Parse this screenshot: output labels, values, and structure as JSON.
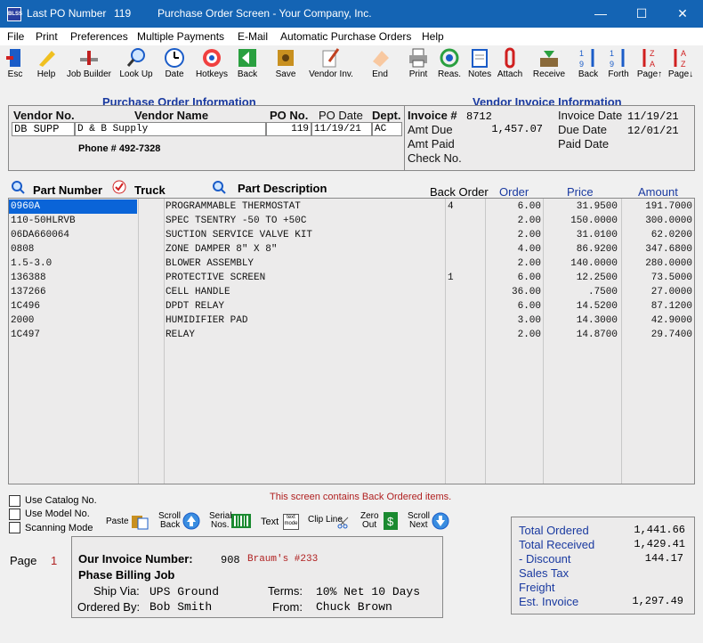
{
  "title_bar": {
    "app_icon": "BLSS",
    "last_po_label": "Last PO Number",
    "last_po_value": "119",
    "window_title": "Purchase Order Screen - Your Company, Inc.",
    "minimize": "—",
    "maximize": "☐",
    "close": "✕"
  },
  "menu": [
    "File",
    "Print",
    "Preferences",
    "Multiple Payments",
    "E-Mail",
    "Automatic Purchase Orders",
    "Help"
  ],
  "toolbar": [
    "Esc",
    "Help",
    "Job Builder",
    "Look Up",
    "Date",
    "Hotkeys",
    "Back",
    "Save",
    "Vendor Inv.",
    "End",
    "Print",
    "Reas.",
    "Notes",
    "Attach",
    "Receive",
    "Back",
    "Forth",
    "Page↑",
    "Page↓"
  ],
  "po_info": {
    "section_title": "Purchase Order Information",
    "vendor_no_label": "Vendor No.",
    "vendor_name_label": "Vendor Name",
    "po_no_label": "PO No.",
    "po_date_label": "PO Date",
    "dept_label": "Dept.",
    "vendor_no": "DB SUPP",
    "vendor_name": "D & B Supply",
    "po_no": "119",
    "po_date": "11/19/21",
    "dept": "AC",
    "phone": "Phone # 492-7328"
  },
  "vendor_invoice": {
    "section_title": "Vendor Invoice Information",
    "invoice_no_label": "Invoice #",
    "invoice_no": "8712",
    "amt_due_label": "Amt Due",
    "amt_due": "1,457.07",
    "amt_paid_label": "Amt Paid",
    "check_no_label": "Check No.",
    "invoice_date_label": "Invoice Date",
    "invoice_date": "11/19/21",
    "due_date_label": "Due Date",
    "due_date": "12/01/21",
    "paid_date_label": "Paid Date"
  },
  "parts_header": {
    "part_number": "Part Number",
    "truck": "Truck",
    "part_description": "Part Description",
    "back_order": "Back Order",
    "order": "Order",
    "price": "Price",
    "amount": "Amount"
  },
  "parts": [
    {
      "part": "0960A",
      "desc": "PROGRAMMABLE THERMOSTAT",
      "back": "4",
      "order": "6.00",
      "price": "31.9500",
      "amount": "191.7000"
    },
    {
      "part": "110-50HLRVB",
      "desc": "SPEC TSENTRY -50 TO +50C",
      "back": "",
      "order": "2.00",
      "price": "150.0000",
      "amount": "300.0000"
    },
    {
      "part": "06DA660064",
      "desc": "SUCTION SERVICE VALVE KIT",
      "back": "",
      "order": "2.00",
      "price": "31.0100",
      "amount": "62.0200"
    },
    {
      "part": "0808",
      "desc": "ZONE DAMPER 8\" X 8\"",
      "back": "",
      "order": "4.00",
      "price": "86.9200",
      "amount": "347.6800"
    },
    {
      "part": "1.5-3.0",
      "desc": "BLOWER ASSEMBLY",
      "back": "",
      "order": "2.00",
      "price": "140.0000",
      "amount": "280.0000"
    },
    {
      "part": "136388",
      "desc": "PROTECTIVE SCREEN",
      "back": "1",
      "order": "6.00",
      "price": "12.2500",
      "amount": "73.5000"
    },
    {
      "part": "137266",
      "desc": "CELL HANDLE",
      "back": "",
      "order": "36.00",
      "price": ".7500",
      "amount": "27.0000"
    },
    {
      "part": "1C496",
      "desc": "DPDT RELAY",
      "back": "",
      "order": "6.00",
      "price": "14.5200",
      "amount": "87.1200"
    },
    {
      "part": "2000",
      "desc": "HUMIDIFIER PAD",
      "back": "",
      "order": "3.00",
      "price": "14.3000",
      "amount": "42.9000"
    },
    {
      "part": "1C497",
      "desc": "RELAY",
      "back": "",
      "order": "2.00",
      "price": "14.8700",
      "amount": "29.7400"
    }
  ],
  "options": {
    "use_catalog": "Use Catalog No.",
    "use_model": "Use Model No.",
    "scanning_mode": "Scanning Mode"
  },
  "back_order_notice": "This screen contains Back Ordered items.",
  "bottom_tools": {
    "paste": "Paste",
    "scroll_back_1": "Scroll",
    "scroll_back_2": "Back",
    "serial_1": "Serial",
    "serial_2": "Nos.",
    "text": "Text",
    "text_icon": "text mode",
    "clip_line": "Clip Line",
    "zero_1": "Zero",
    "zero_2": "Out",
    "scroll_next_1": "Scroll",
    "scroll_next_2": "Next"
  },
  "page": {
    "label": "Page",
    "value": "1"
  },
  "our_invoice": {
    "label": "Our Invoice Number:",
    "number": "908",
    "ref": "Braum's #233",
    "phase": "Phase Billing Job",
    "ship_via_label": "Ship Via:",
    "ship_via": "UPS Ground",
    "terms_label": "Terms:",
    "terms": "10% Net 10 Days",
    "ordered_by_label": "Ordered By:",
    "ordered_by": "Bob Smith",
    "from_label": "From:",
    "from": "Chuck Brown"
  },
  "totals": {
    "total_ordered_label": "Total Ordered",
    "total_ordered": "1,441.66",
    "total_received_label": "Total Received",
    "total_received": "1,429.41",
    "discount_label": "- Discount",
    "discount": "144.17",
    "sales_tax_label": "Sales Tax",
    "freight_label": "Freight",
    "est_invoice_label": "Est. Invoice",
    "est_invoice": "1,297.49"
  }
}
